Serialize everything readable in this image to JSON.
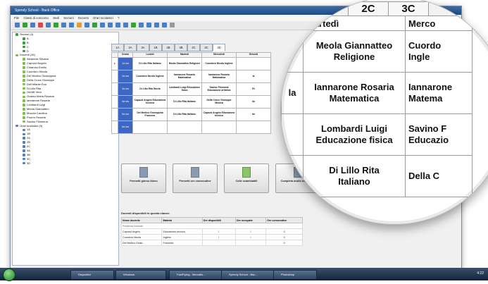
{
  "window": {
    "title": "Spendy School - Back Office",
    "menu": [
      "File",
      "Classi di concorso",
      "Sedi",
      "Sezioni",
      "Docenti",
      "Orari scolastici",
      "?"
    ]
  },
  "tree": {
    "items": [
      {
        "label": "Sezioni (4)",
        "level": 0,
        "color": "#3a9f3a"
      },
      {
        "label": "A",
        "level": 1,
        "color": "#3a9f3a"
      },
      {
        "label": "B",
        "level": 1,
        "color": "#3a9f3a"
      },
      {
        "label": "C",
        "level": 1,
        "color": "#3a9f3a"
      },
      {
        "label": "D",
        "level": 1,
        "color": "#3a9f3a"
      },
      {
        "label": "Docenti (16)",
        "level": 0,
        "color": "#7fbf4a"
      },
      {
        "label": "Albanese Silvana",
        "level": 1,
        "color": "#7fbf4a"
      },
      {
        "label": "Capozzi Angelo",
        "level": 1,
        "color": "#7fbf4a"
      },
      {
        "label": "Chiaroso Emilio",
        "level": 1,
        "color": "#7fbf4a"
      },
      {
        "label": "Cuordoro Nicola",
        "level": 1,
        "color": "#7fbf4a"
      },
      {
        "label": "Del Medico Giuseppina",
        "level": 1,
        "color": "#7fbf4a"
      },
      {
        "label": "Della Croce Giuseppe",
        "level": 1,
        "color": "#7fbf4a"
      },
      {
        "label": "Dell'Infante Eva",
        "level": 1,
        "color": "#7fbf4a"
      },
      {
        "label": "Di Lillo Rita",
        "level": 1,
        "color": "#7fbf4a"
      },
      {
        "label": "Gentili Vera",
        "level": 1,
        "color": "#7fbf4a"
      },
      {
        "label": "Grasso Maria Rosaria",
        "level": 1,
        "color": "#7fbf4a"
      },
      {
        "label": "Iannarone Rosaria",
        "level": 1,
        "color": "#7fbf4a"
      },
      {
        "label": "Lombardi Luigi",
        "level": 1,
        "color": "#7fbf4a"
      },
      {
        "label": "Meola Giannatteo",
        "level": 1,
        "color": "#7fbf4a"
      },
      {
        "label": "Moccia Carolina",
        "level": 1,
        "color": "#7fbf4a"
      },
      {
        "label": "Puorro Rosaria",
        "level": 1,
        "color": "#7fbf4a"
      },
      {
        "label": "Savino Filomena",
        "level": 1,
        "color": "#7fbf4a"
      },
      {
        "label": "Orari scolastici (9)",
        "level": 0,
        "color": "#5a7fbf"
      },
      {
        "label": "1A",
        "level": 1,
        "color": "#5a7fbf"
      },
      {
        "label": "1B",
        "level": 1,
        "color": "#5a7fbf"
      },
      {
        "label": "2A",
        "level": 1,
        "color": "#5a7fbf"
      },
      {
        "label": "2B",
        "level": 1,
        "color": "#5a7fbf"
      },
      {
        "label": "2C",
        "level": 1,
        "color": "#5a7fbf"
      },
      {
        "label": "3A",
        "level": 1,
        "color": "#5a7fbf"
      },
      {
        "label": "3B",
        "level": 1,
        "color": "#5a7fbf"
      },
      {
        "label": "3C",
        "level": 1,
        "color": "#5a7fbf"
      },
      {
        "label": "3D",
        "level": 1,
        "color": "#5a7fbf"
      }
    ]
  },
  "tabs": [
    "1A",
    "2A",
    "3A",
    "1B",
    "2B",
    "3B",
    "2C",
    "3C",
    "3D"
  ],
  "active_tab": "3D",
  "schedule": {
    "headers": [
      "Orario",
      "Lunedì",
      "Martedì",
      "Mercoledì",
      "Giovedì"
    ],
    "rows": [
      {
        "hour": "1a ora",
        "cells": [
          "Di Lillo Rita Italiano",
          "Meola Giannatteo Religione",
          "Cuordoro Nicola Inglese",
          ""
        ]
      },
      {
        "hour": "2a ora",
        "cells": [
          "Cuordoro Nicola Inglese",
          "Iannarone Rosaria Matematica",
          "Iannarone Rosaria Matematica",
          "la"
        ]
      },
      {
        "hour": "3a ora",
        "cells": [
          "Di Lillo Rita Storia",
          "Lombardi Luigi Educazione fisica",
          "Savino Filomena Educazione artistica",
          "Ri"
        ]
      },
      {
        "hour": "4a ora",
        "cells": [
          "Capozzi Angelo Educazione tecnica",
          "Di Lillo Rita Italiano",
          "Della Croce Giuseppe Musica",
          "Im"
        ]
      },
      {
        "hour": "5a ora",
        "cells": [
          "Del Medico Giuseppina Francese",
          "Di Lillo Rita Italiano",
          "Capozzi Angelo Educazione tecnica",
          "Im"
        ]
      },
      {
        "hour": "6a ora",
        "cells": [
          "",
          "",
          "",
          ""
        ]
      }
    ]
  },
  "actions": [
    {
      "label": "Permetti giorno libero"
    },
    {
      "label": "Permetti ore consecutive"
    },
    {
      "label": "Celle scambiabili"
    },
    {
      "label": "Completa orario scolastico"
    }
  ],
  "available": {
    "caption": "Docenti disponibili in questa classe:",
    "headers": [
      "Nome docente",
      "Materia",
      "Ore disponibili",
      "Ore occupate",
      "Ore consecutive"
    ],
    "group": "Presenza Normali",
    "rows": [
      {
        "name": "Capozzi Angelo",
        "subject": "Educazione tecnica",
        "available": "1",
        "occupied": "1",
        "consecutive": "0"
      },
      {
        "name": "Cuordoro Nicola",
        "subject": "Inglese",
        "available": "1",
        "occupied": "1",
        "consecutive": "0"
      },
      {
        "name": "Del Medico Giuse...",
        "subject": "Francese",
        "available": "",
        "occupied": "",
        "consecutive": "0"
      }
    ]
  },
  "magnifier": {
    "tabs": [
      "2C",
      "3C"
    ],
    "headers": [
      "Martedì",
      "Merco"
    ],
    "rows": [
      [
        "Meola Giannatteo",
        "Religione",
        "Cuordo",
        "Ingle"
      ],
      [
        "Iannarone Rosaria",
        "Matematica",
        "Iannarone",
        "Matema"
      ],
      [
        "Lombardi Luigi",
        "Educazione fisica",
        "Savino F",
        "Educazio"
      ],
      [
        "Di Lillo Rita",
        "Italiano",
        "Della C",
        ""
      ]
    ],
    "left_edge": [
      "",
      "la",
      "",
      ""
    ]
  },
  "taskbar": {
    "items": [
      "Dispositivi",
      "Windows",
      "FastFlying - Mercatis...",
      "Spendy School - Bac...",
      "Photoshop"
    ],
    "clock": "4:22"
  }
}
